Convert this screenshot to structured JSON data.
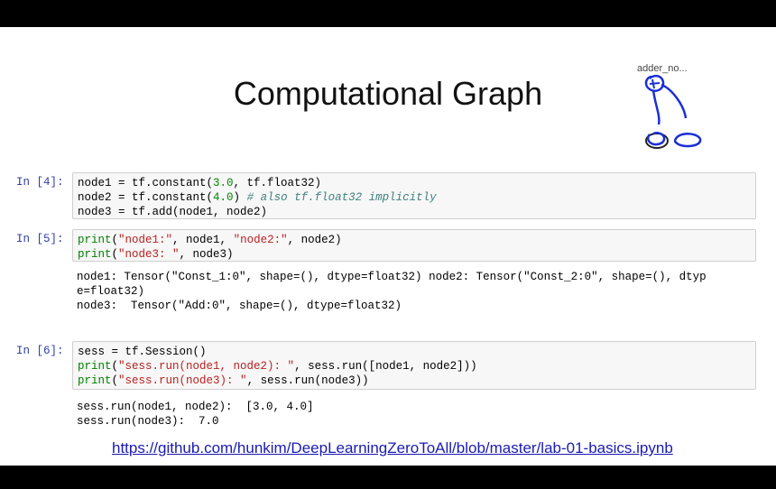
{
  "slide": {
    "title": "Computational Graph",
    "scribble_label": "adder_no..."
  },
  "cells": [
    {
      "prompt": "In [4]:",
      "code": [
        [
          {
            "t": "node1 = tf.constant("
          },
          {
            "t": "3.0",
            "c": "num"
          },
          {
            "t": ", tf.float32)"
          }
        ],
        [
          {
            "t": "node2 = tf.constant("
          },
          {
            "t": "4.0",
            "c": "num"
          },
          {
            "t": ") "
          },
          {
            "t": "# also tf.float32 implicitly",
            "c": "cm"
          }
        ],
        [
          {
            "t": "node3 = tf.add(node1, node2)"
          }
        ]
      ],
      "output": []
    },
    {
      "prompt": "In [5]:",
      "code": [
        [
          {
            "t": "print",
            "c": "kw"
          },
          {
            "t": "("
          },
          {
            "t": "\"node1:\"",
            "c": "str"
          },
          {
            "t": ", node1, "
          },
          {
            "t": "\"node2:\"",
            "c": "str"
          },
          {
            "t": ", node2)"
          }
        ],
        [
          {
            "t": "print",
            "c": "kw"
          },
          {
            "t": "("
          },
          {
            "t": "\"node3: \"",
            "c": "str"
          },
          {
            "t": ", node3)"
          }
        ]
      ],
      "output": [
        "node1: Tensor(\"Const_1:0\", shape=(), dtype=float32) node2: Tensor(\"Const_2:0\", shape=(), dtyp",
        "e=float32)",
        "node3:  Tensor(\"Add:0\", shape=(), dtype=float32)"
      ]
    },
    {
      "prompt": "In [6]:",
      "code": [
        [
          {
            "t": "sess = tf.Session()"
          }
        ],
        [
          {
            "t": "print",
            "c": "kw"
          },
          {
            "t": "("
          },
          {
            "t": "\"sess.run(node1, node2): \"",
            "c": "str"
          },
          {
            "t": ", sess.run([node1, node2]))"
          }
        ],
        [
          {
            "t": "print",
            "c": "kw"
          },
          {
            "t": "("
          },
          {
            "t": "\"sess.run(node3): \"",
            "c": "str"
          },
          {
            "t": ", sess.run(node3))"
          }
        ]
      ],
      "output": [
        "sess.run(node1, node2):  [3.0, 4.0]",
        "sess.run(node3):  7.0"
      ]
    }
  ],
  "footer": {
    "link": "https://github.com/hunkim/DeepLearningZeroToAll/blob/master/lab-01-basics.ipynb"
  }
}
